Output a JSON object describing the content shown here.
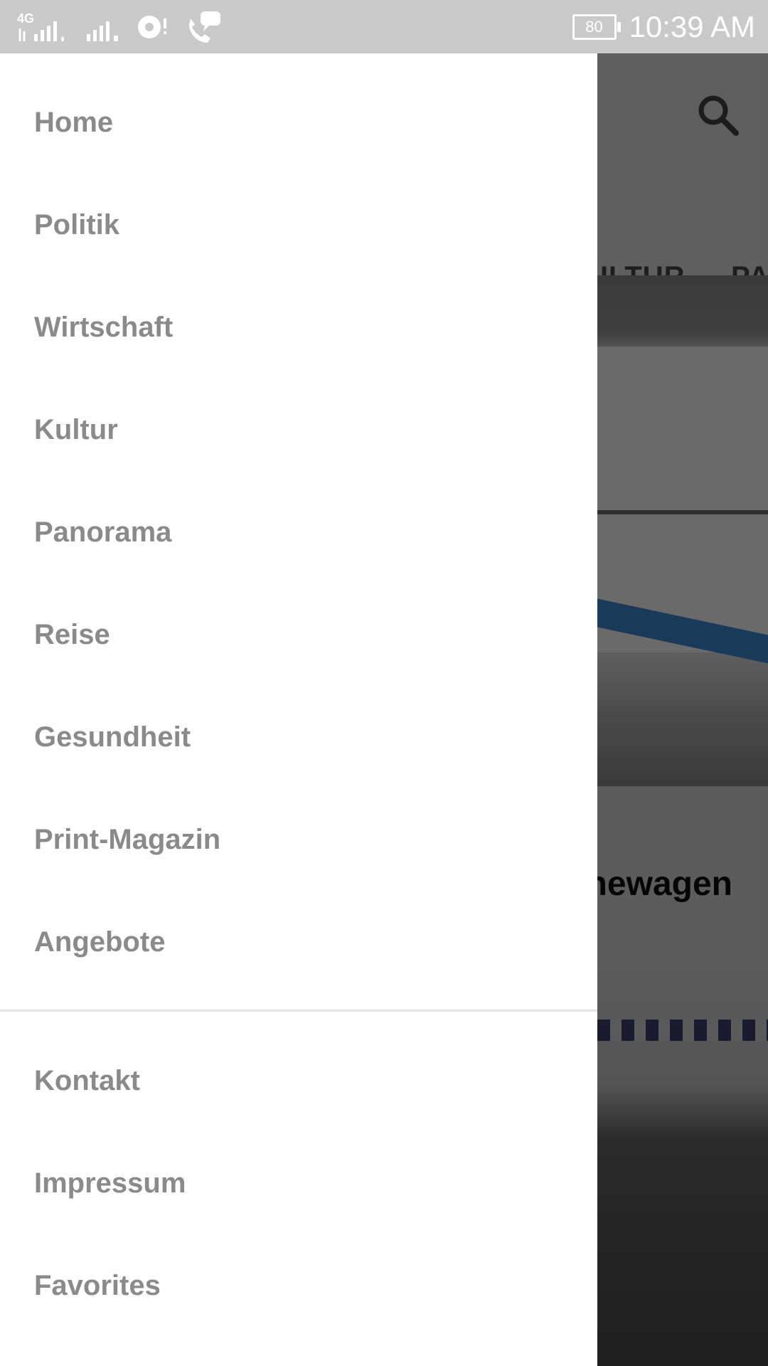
{
  "status_bar": {
    "network_label": "4G",
    "time": "10:39 AM",
    "battery": "80"
  },
  "background": {
    "tabs": [
      "ULTUR",
      "PA"
    ],
    "article_title": "newagen"
  },
  "drawer": {
    "primary_items": [
      {
        "label": "Home"
      },
      {
        "label": "Politik"
      },
      {
        "label": "Wirtschaft"
      },
      {
        "label": "Kultur"
      },
      {
        "label": "Panorama"
      },
      {
        "label": "Reise"
      },
      {
        "label": "Gesundheit"
      },
      {
        "label": "Print-Magazin"
      },
      {
        "label": "Angebote"
      }
    ],
    "secondary_items": [
      {
        "label": "Kontakt"
      },
      {
        "label": "Impressum"
      },
      {
        "label": "Favorites"
      }
    ]
  },
  "colors": {
    "status_bar": "#c9c9c9",
    "drawer_bg": "#ffffff",
    "drawer_text": "#8a8a8a",
    "scrim": "#5c5c5c"
  }
}
